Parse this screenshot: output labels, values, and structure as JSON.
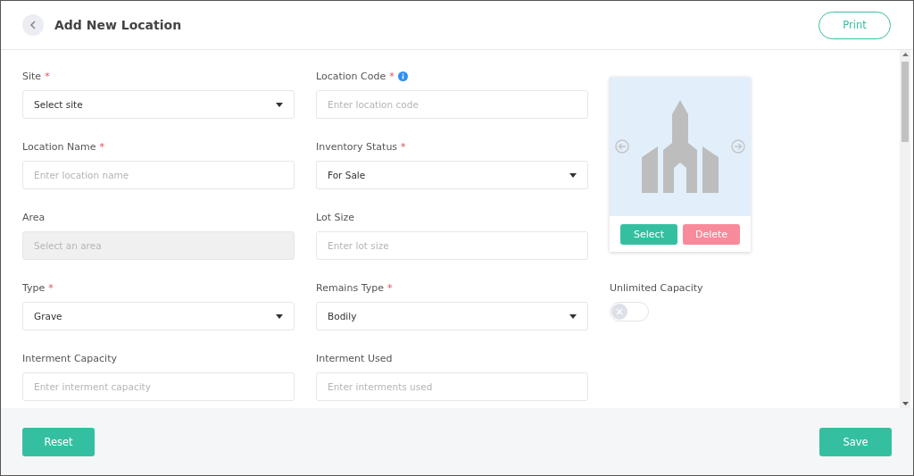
{
  "header": {
    "title": "Add New Location",
    "print_button": "Print"
  },
  "fields": [
    {
      "label": "Site",
      "required_mark": "*",
      "kind": "select",
      "value": "Select site"
    },
    {
      "label": "Location Code",
      "required_mark": "*",
      "info": true,
      "kind": "input",
      "placeholder": "Enter location code"
    },
    {
      "label": "Location Name",
      "required_mark": "*",
      "kind": "input",
      "placeholder": "Enter location name"
    },
    {
      "label": "Inventory Status",
      "required_mark": "*",
      "kind": "select",
      "value": "For Sale"
    },
    {
      "label": "Area",
      "kind": "disabled",
      "placeholder": "Select an area"
    },
    {
      "label": "Lot Size",
      "kind": "input",
      "placeholder": "Enter lot size"
    },
    {
      "label": "Type",
      "required_mark": "*",
      "kind": "select",
      "value": "Grave"
    },
    {
      "label": "Remains Type",
      "required_mark": "*",
      "kind": "select",
      "value": "Bodily"
    },
    {
      "label": "Unlimited Capacity",
      "kind": "toggle",
      "on": false
    },
    {
      "label": "Interment Capacity",
      "kind": "input",
      "placeholder": "Enter interment capacity"
    },
    {
      "label": "Interment Used",
      "kind": "input",
      "placeholder": "Enter interments used"
    }
  ],
  "image_panel": {
    "select_button": "Select",
    "delete_button": "Delete"
  },
  "footer": {
    "reset_button": "Reset",
    "save_button": "Save"
  }
}
